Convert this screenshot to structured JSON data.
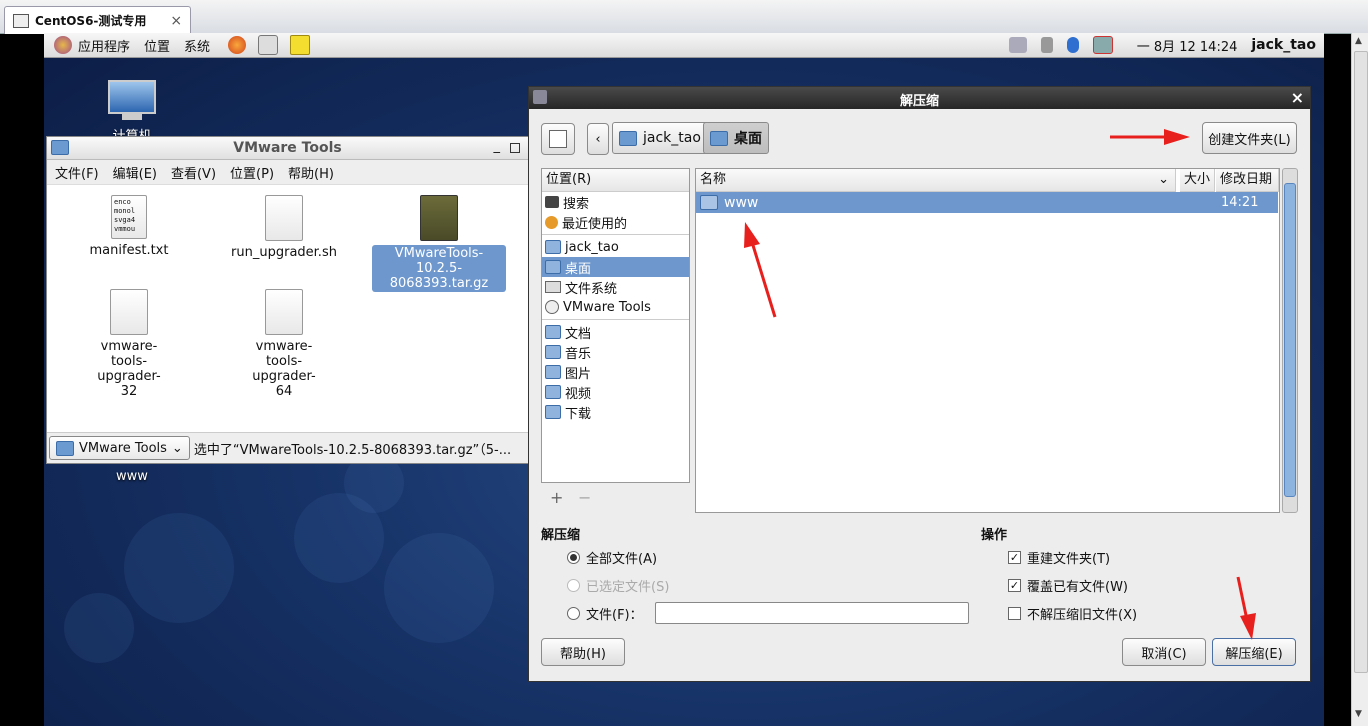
{
  "host": {
    "tab_title": "CentOS6-测试专用",
    "tab_close": "×"
  },
  "panel": {
    "menus": [
      "应用程序",
      "位置",
      "系统"
    ],
    "datetime": "一 8月 12 14:24",
    "user": "jack_tao"
  },
  "desktop": {
    "computer_label": "计算机",
    "www_label": "www"
  },
  "nautilus": {
    "title": "VMware Tools",
    "menus": [
      "文件(F)",
      "编辑(E)",
      "查看(V)",
      "位置(P)",
      "帮助(H)"
    ],
    "files": [
      {
        "name": "manifest.txt",
        "thumb": "enco\nmonol\nsvga4\nvmmou"
      },
      {
        "name": "run_upgrader.sh"
      },
      {
        "name": "VMwareTools-10.2.5-8068393.tar.gz"
      },
      {
        "name": "vmware-tools-upgrader-32"
      },
      {
        "name": "vmware-tools-upgrader-64"
      }
    ],
    "location": "VMware Tools",
    "status": "选中了“VMwareTools-10.2.5-8068393.tar.gz”（5-..."
  },
  "dialog": {
    "title": "解压缩",
    "close": "×",
    "path": [
      "jack_tao",
      "桌面"
    ],
    "create_folder": "创建文件夹(L)",
    "places_header": "位置(R)",
    "places": [
      "搜索",
      "最近使用的",
      "jack_tao",
      "桌面",
      "文件系统",
      "VMware Tools",
      "文档",
      "音乐",
      "图片",
      "视频",
      "下载"
    ],
    "columns": {
      "name": "名称",
      "size": "大小",
      "modified": "修改日期"
    },
    "rows": [
      {
        "name": "www",
        "modified": "14:21"
      }
    ],
    "extract_section": "解压缩",
    "radio_all": "全部文件(A)",
    "radio_selected": "已选定文件(S)",
    "radio_files": "文件(F)：",
    "actions_section": "操作",
    "chk_recreate": "重建文件夹(T)",
    "chk_overwrite": "覆盖已有文件(W)",
    "chk_no_older": "不解压缩旧文件(X)",
    "help": "帮助(H)",
    "cancel": "取消(C)",
    "extract": "解压缩(E)"
  },
  "colors": {
    "accent": "#6d97cd",
    "arrow": "#e8201d"
  }
}
